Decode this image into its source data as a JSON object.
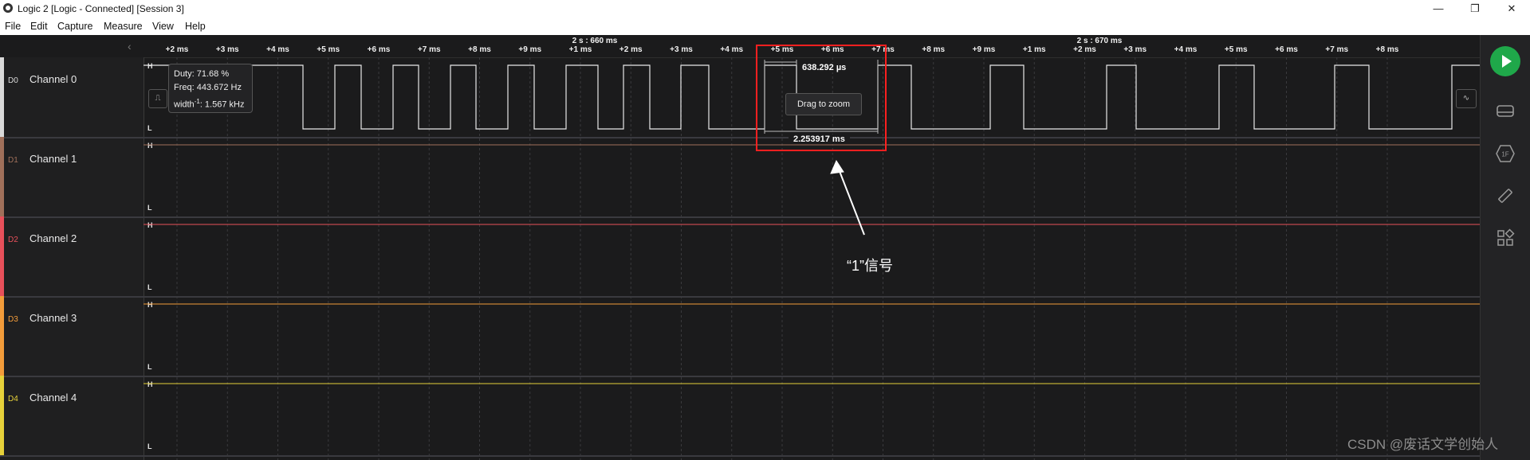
{
  "window": {
    "title": "Logic 2 [Logic - Connected] [Session 3]",
    "minimize": "—",
    "maximize": "❐",
    "close": "✕"
  },
  "menu": [
    "File",
    "Edit",
    "Capture",
    "Measure",
    "View",
    "Help"
  ],
  "timeline": {
    "major": [
      "2 s : 660 ms",
      "2 s : 670 ms"
    ],
    "ticks": [
      "+2 ms",
      "+3 ms",
      "+4 ms",
      "+5 ms",
      "+6 ms",
      "+7 ms",
      "+8 ms",
      "+9 ms",
      "+1 ms",
      "+2 ms",
      "+3 ms",
      "+4 ms",
      "+5 ms",
      "+6 ms",
      "+7 ms",
      "+8 ms",
      "+9 ms",
      "+1 ms",
      "+2 ms",
      "+3 ms",
      "+4 ms",
      "+5 ms",
      "+6 ms",
      "+7 ms",
      "+8 ms"
    ]
  },
  "channels": [
    {
      "dlabel": "D0",
      "name": "Channel 0",
      "color": "#d9d9d9"
    },
    {
      "dlabel": "D1",
      "name": "Channel 1",
      "color": "#a0705a"
    },
    {
      "dlabel": "D2",
      "name": "Channel 2",
      "color": "#e8505a"
    },
    {
      "dlabel": "D3",
      "name": "Channel 3",
      "color": "#f39c3a"
    },
    {
      "dlabel": "D4",
      "name": "Channel 4",
      "color": "#e6d13a"
    }
  ],
  "level_labels": {
    "high": "H",
    "low": "L"
  },
  "tooltip": {
    "duty": "Duty: 71.68 %",
    "freq": "Freq: 443.672 Hz",
    "width_prefix": "width",
    "width_sup": "-1",
    "width_value": ": 1.567 kHz"
  },
  "measure": {
    "pulse_width": "638.292 µs",
    "period": "2.253917 ms",
    "drag_zoom": "Drag to zoom"
  },
  "annotation": "“1”信号",
  "watermark": "CSDN @废话文学创始人",
  "colors": {
    "accent_play": "#1fa84a",
    "highlight_box": "#ff2020"
  },
  "icons": [
    "play-icon",
    "waveform-bar-icon",
    "analyzer-1f-icon",
    "ruler-icon",
    "extensions-icon"
  ]
}
